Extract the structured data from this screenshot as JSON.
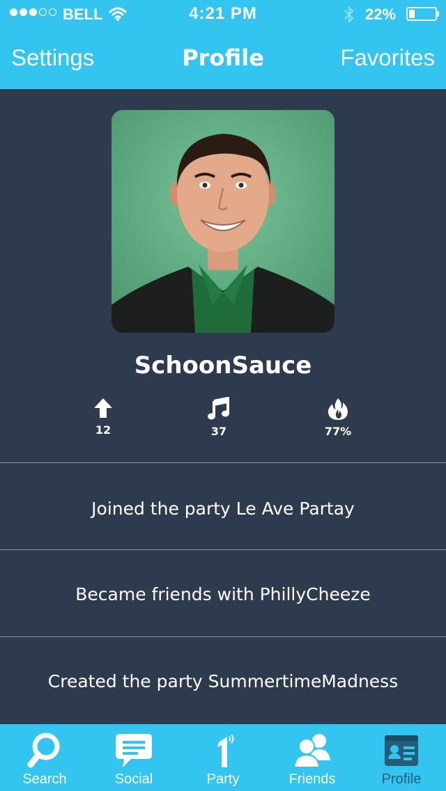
{
  "status_bar": {
    "carrier": "BELL",
    "time": "4:21 PM",
    "battery_percent_text": "22%",
    "battery_level": 0.22,
    "signal_bars_filled": 3,
    "signal_bars_total": 5
  },
  "nav": {
    "left_label": "Settings",
    "title": "Profile",
    "right_label": "Favorites"
  },
  "profile": {
    "username": "SchoonSauce",
    "stats": [
      {
        "icon": "arrow-up-icon",
        "value": "12"
      },
      {
        "icon": "music-note-icon",
        "value": "37"
      },
      {
        "icon": "flame-icon",
        "value": "77%"
      }
    ]
  },
  "activity": [
    "Joined the party Le Ave Partay",
    "Became friends with PhillyCheeze",
    "Created the party SummertimeMadness"
  ],
  "tabs": [
    {
      "label": "Search",
      "icon": "search-icon"
    },
    {
      "label": "Social",
      "icon": "chat-bubble-icon"
    },
    {
      "label": "Party",
      "icon": "party-one-icon"
    },
    {
      "label": "Friends",
      "icon": "friends-icon"
    },
    {
      "label": "Profile",
      "icon": "profile-card-icon",
      "active": true
    }
  ],
  "colors": {
    "accent": "#33c4f0",
    "background": "#2e3b4e",
    "active_tab": "#245d78"
  }
}
